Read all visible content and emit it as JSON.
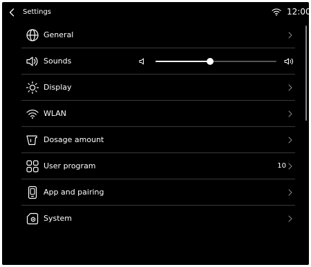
{
  "header": {
    "title": "Settings",
    "time": "12:00"
  },
  "menu": {
    "general": {
      "label": "General",
      "icon": "globe-icon"
    },
    "sounds": {
      "label": "Sounds",
      "icon": "speaker-icon",
      "volume_level": 0.45
    },
    "display": {
      "label": "Display",
      "icon": "sun-icon"
    },
    "wlan": {
      "label": "WLAN",
      "icon": "wifi-icon"
    },
    "dosage": {
      "label": "Dosage amount",
      "icon": "cup-icon"
    },
    "user_program": {
      "label": "User program",
      "icon": "grid-icon",
      "value": "10"
    },
    "app_pairing": {
      "label": "App and pairing",
      "icon": "phone-icon"
    },
    "system": {
      "label": "System",
      "icon": "system-gear-icon"
    }
  },
  "scrollbar": {
    "visible_fraction": 0.4
  },
  "colors": {
    "background": "#000000",
    "text": "#ffffff",
    "divider": "#3a3a3a",
    "slider_track": "#555555"
  }
}
